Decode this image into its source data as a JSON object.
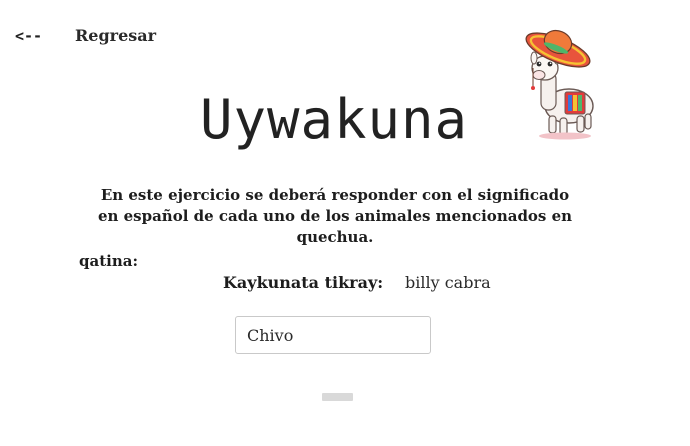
{
  "nav": {
    "back_arrow": "<--",
    "back_label": "Regresar"
  },
  "header": {
    "title": "Uywakuna"
  },
  "mascot": {
    "icon": "llama-with-sombrero-icon"
  },
  "exercise": {
    "instructions": "En este ejercicio se deberá responder con el significado en español de cada uno de los animales mencionados en quechua.",
    "word": "qatina:",
    "hint_label": "Kaykunata tikray:",
    "hint_value": "billy cabra",
    "answer_value": "Chivo"
  },
  "colors": {
    "text": "#1f1f1f",
    "input_border": "#c9c9c9",
    "button": "#d9d9d9"
  }
}
